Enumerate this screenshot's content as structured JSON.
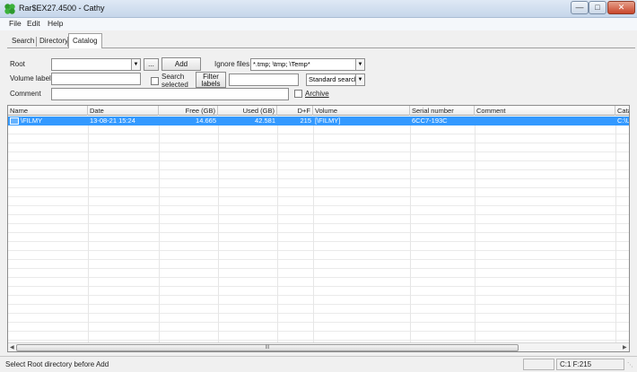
{
  "window": {
    "title": "Rar$EX27.4500 - Cathy"
  },
  "menu": [
    "File",
    "Edit",
    "Help"
  ],
  "tabs": [
    {
      "label": "Search",
      "active": false
    },
    {
      "label": "Directory",
      "active": false
    },
    {
      "label": "Catalog",
      "active": true
    }
  ],
  "form": {
    "root_label": "Root",
    "root_value": "",
    "browse_label": "...",
    "add_label": "Add",
    "ignore_files_label": "Ignore files",
    "ignore_files_value": "*.tmp; \\tmp; \\Temp*",
    "volume_label_label": "Volume label",
    "volume_label_value": "",
    "search_selected_label_1": "Search",
    "search_selected_label_2": "selected",
    "filter_labels_label_1": "Filter",
    "filter_labels_label_2": "labels",
    "filter_value": "",
    "search_mode_value": "Standard search",
    "comment_label": "Comment",
    "comment_value": "",
    "archive_label": "Archive"
  },
  "table": {
    "columns": [
      "Name",
      "Date",
      "Free (GB)",
      "Used (GB)",
      "D+F",
      "Volume",
      "Serial number",
      "Comment",
      "Cata"
    ],
    "rows": [
      {
        "name": "\\FILMY",
        "date": "13-08-21 15:24",
        "free": "14.665",
        "used": "42.581",
        "df": "215",
        "volume": "[\\FILMY]",
        "serial": "6CC7-193C",
        "comment": "",
        "catalog": "C:\\U"
      }
    ]
  },
  "scrollbar": {
    "thumb_grip": "III"
  },
  "status": {
    "message": "Select Root directory before Add",
    "panel_1": "",
    "panel_2": "C:1 F:215"
  },
  "icons": {
    "app": "green-clover-icon",
    "combo": "chevron-down-icon",
    "row": "catalog-row-icon"
  },
  "colors": {
    "selection": "#3399ff",
    "title_gradient_top": "#dfe9f5",
    "close_button": "#c9452b"
  }
}
